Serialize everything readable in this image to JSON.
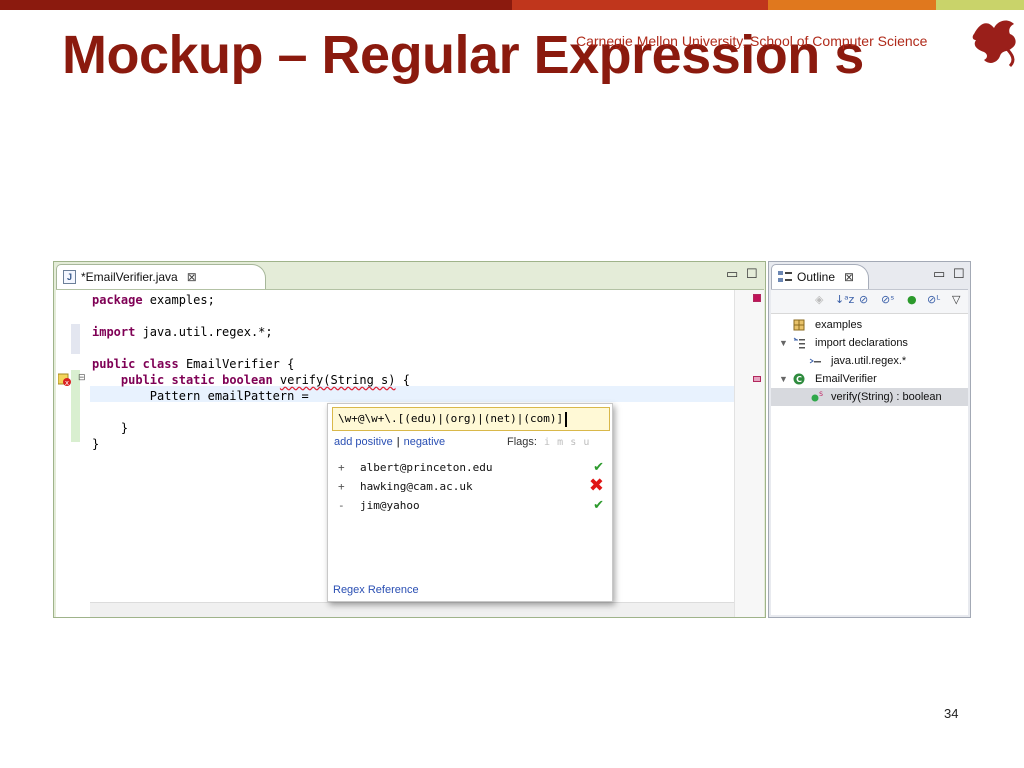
{
  "slide": {
    "title": "Mockup – Regular Expression s",
    "affiliation": "Carnegie Mellon University, School of Computer Science",
    "page_number": "34",
    "colors": {
      "title": "#8b1a0e",
      "bar": [
        "#8b1a0e",
        "#c0361c",
        "#e05a1e",
        "#f0a020",
        "#c9d36a"
      ]
    }
  },
  "editor": {
    "tab_label": "*EmailVerifier.java",
    "tab_icon": "java-file-icon",
    "code_lines": [
      [
        {
          "t": "package",
          "k": 1
        },
        {
          "t": " examples;"
        }
      ],
      [],
      [
        {
          "t": "import",
          "k": 1
        },
        {
          "t": " java.util.regex.*;"
        }
      ],
      [],
      [
        {
          "t": "public",
          "k": 1
        },
        {
          "t": " "
        },
        {
          "t": "class",
          "k": 1
        },
        {
          "t": " EmailVerifier {"
        }
      ],
      [
        {
          "t": "    "
        },
        {
          "t": "public",
          "k": 1
        },
        {
          "t": " "
        },
        {
          "t": "static",
          "k": 1
        },
        {
          "t": " "
        },
        {
          "t": "boolean",
          "k": 1
        },
        {
          "t": " "
        },
        {
          "t": "verify(String s)",
          "s": 1
        },
        {
          "t": " {"
        }
      ],
      [
        {
          "t": "        Pattern emailPattern = "
        }
      ],
      [],
      [
        {
          "t": "    }"
        }
      ],
      [
        {
          "t": "}"
        }
      ]
    ]
  },
  "regex_popup": {
    "pattern": "\\w+@\\w+\\.[(edu)|(org)|(net)|(com)]",
    "add_positive": "add positive",
    "separator": "|",
    "add_negative": "negative",
    "flags_label": "Flags:",
    "flags": [
      "i",
      "m",
      "s",
      "u"
    ],
    "examples": [
      {
        "sign": "+",
        "text": "albert@princeton.edu",
        "result": "pass"
      },
      {
        "sign": "+",
        "text": "hawking@cam.ac.uk",
        "result": "fail"
      },
      {
        "sign": "-",
        "text": "jim@yahoo",
        "result": "pass"
      }
    ],
    "reference_link": "Regex Reference"
  },
  "outline": {
    "tab_label": "Outline",
    "items": [
      {
        "label": "examples",
        "icon": "package-icon",
        "depth": 0,
        "twisty": ""
      },
      {
        "label": "import declarations",
        "icon": "imports-icon",
        "depth": 0,
        "twisty": "▼"
      },
      {
        "label": "java.util.regex.*",
        "icon": "import-icon",
        "depth": 1,
        "twisty": ""
      },
      {
        "label": "EmailVerifier",
        "icon": "class-icon",
        "depth": 0,
        "twisty": "▼"
      },
      {
        "label": "verify(String) : boolean",
        "icon": "method-icon",
        "depth": 1,
        "twisty": "",
        "selected": true
      }
    ]
  }
}
